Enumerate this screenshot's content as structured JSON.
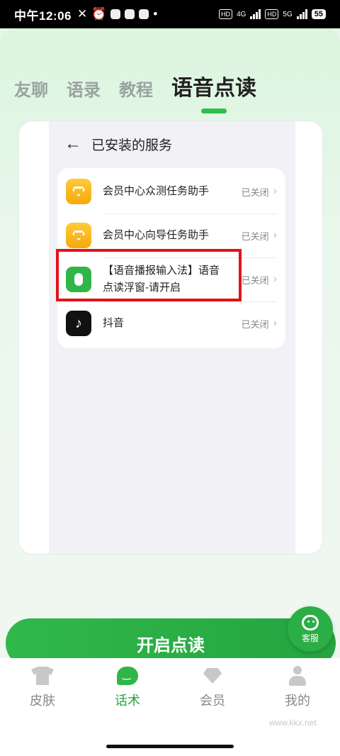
{
  "status_bar": {
    "time": "中午12:06",
    "network_hd1": "HD",
    "network_4g": "4G",
    "network_hd2": "HD",
    "network_5g": "5G",
    "battery": "55"
  },
  "tabs": [
    {
      "label": "友聊"
    },
    {
      "label": "语录"
    },
    {
      "label": "教程"
    },
    {
      "label": "语音点读",
      "active": true
    }
  ],
  "preview": {
    "header_title": "已安装的服务",
    "services": [
      {
        "name": "会员中心众测任务助手",
        "status": "已关闭",
        "icon": "gold-diamond-icon"
      },
      {
        "name": "会员中心向导任务助手",
        "status": "已关闭",
        "icon": "gold-diamond-icon"
      },
      {
        "name": "【语音播报输入法】语音点读浮窗-请开启",
        "status": "已关闭",
        "icon": "voice-input-icon",
        "highlighted": true
      },
      {
        "name": "抖音",
        "status": "已关闭",
        "icon": "tiktok-icon"
      }
    ]
  },
  "cta": {
    "label": "开启点读"
  },
  "kefu": {
    "label": "客服"
  },
  "bottom_nav": [
    {
      "label": "皮肤",
      "icon": "shirt-icon"
    },
    {
      "label": "话术",
      "icon": "chat-icon",
      "active": true
    },
    {
      "label": "会员",
      "icon": "diamond-icon"
    },
    {
      "label": "我的",
      "icon": "person-icon"
    }
  ],
  "watermark": "www.kkx.net",
  "colors": {
    "accent": "#2fb548",
    "highlight_box": "#e0131a"
  }
}
